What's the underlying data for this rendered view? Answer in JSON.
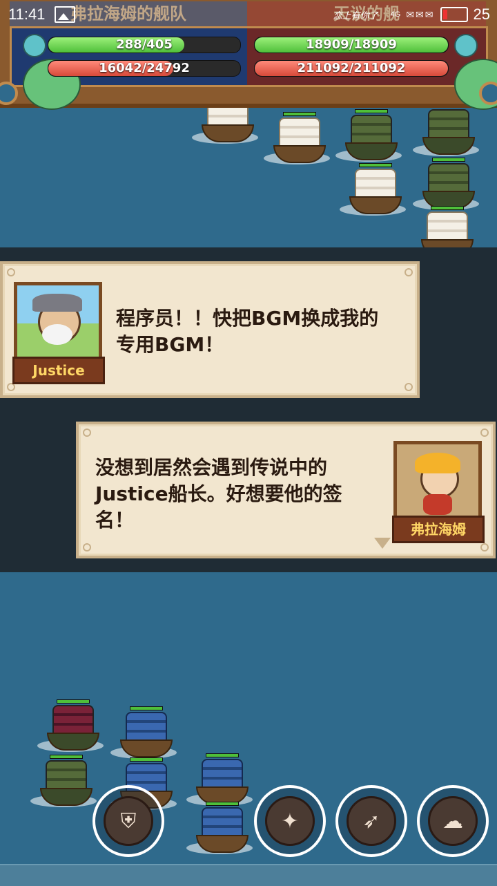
{
  "status_bar": {
    "time": "11:41",
    "battery": "25",
    "brand": "恋上有你了",
    "signal": "4G"
  },
  "hud": {
    "left_title": "弗拉海姆的舰队",
    "right_title": "天议的舰",
    "left": {
      "crew": "288/405",
      "crew_fraction": 0.71,
      "hull": "16042/24792",
      "hull_fraction": 0.65
    },
    "right": {
      "crew": "18909/18909",
      "crew_fraction": 1.0,
      "hull": "211092/211092",
      "hull_fraction": 1.0
    }
  },
  "dialog": [
    {
      "speaker": "Justice",
      "text": "程序员！！快把BGM换成我的专用BGM！"
    },
    {
      "speaker": "弗拉海姆",
      "text": "没想到居然会遇到传说中的Justice船长。好想要他的签名！"
    }
  ],
  "skills": [
    {
      "icon": "shield-icon"
    },
    {
      "icon": "burst-icon"
    },
    {
      "icon": "wolf-icon"
    },
    {
      "icon": "sheep-icon"
    }
  ],
  "colors": {
    "sea": "#2f6a8c",
    "hp_green": "#4fbf3a",
    "hp_red": "#d84a3a",
    "nameplate_text": "#ffd766"
  }
}
